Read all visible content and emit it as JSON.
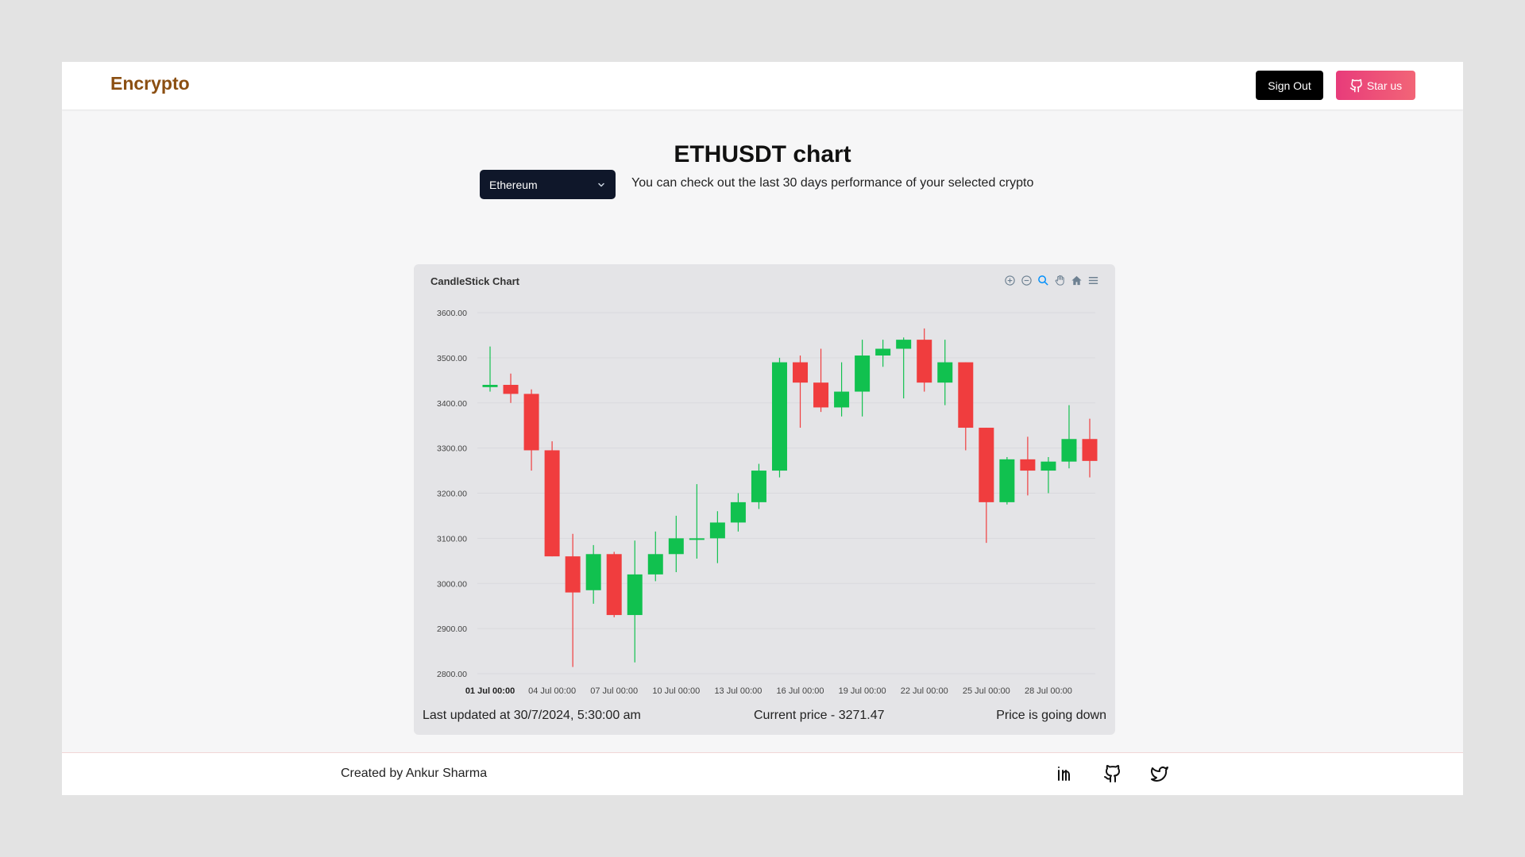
{
  "header": {
    "logo": "Encrypto",
    "signout_label": "Sign Out",
    "star_label": "Star us"
  },
  "main": {
    "title": "ETHUSDT chart",
    "select": {
      "selected": "Ethereum"
    },
    "subtitle": "You can check out the last 30 days performance of your selected crypto"
  },
  "chart_card": {
    "title": "CandleStick Chart",
    "toolbar_icons": [
      "zoom-in-icon",
      "zoom-out-icon",
      "zoom-selection-icon",
      "pan-hand-icon",
      "reset-home-icon",
      "menu-icon"
    ],
    "footer": {
      "updated": "Last updated at 30/7/2024, 5:30:00 am",
      "current_price": "Current price - 3271.47",
      "trend": "Price is going down"
    }
  },
  "chart_data": {
    "type": "candlestick",
    "title": "CandleStick Chart",
    "colors": {
      "up": "#11c14f",
      "down": "#f03d3e"
    },
    "ylim": [
      2800,
      3600
    ],
    "yticks": [
      "3600.00",
      "3500.00",
      "3400.00",
      "3300.00",
      "3200.00",
      "3100.00",
      "3000.00",
      "2900.00",
      "2800.00"
    ],
    "xticks": [
      {
        "label": "01 Jul 00:00",
        "index": 0,
        "bold": true
      },
      {
        "label": "04 Jul 00:00",
        "index": 3
      },
      {
        "label": "07 Jul 00:00",
        "index": 6
      },
      {
        "label": "10 Jul 00:00",
        "index": 9
      },
      {
        "label": "13 Jul 00:00",
        "index": 12
      },
      {
        "label": "16 Jul 00:00",
        "index": 15
      },
      {
        "label": "19 Jul 00:00",
        "index": 18
      },
      {
        "label": "22 Jul 00:00",
        "index": 21
      },
      {
        "label": "25 Jul 00:00",
        "index": 24
      },
      {
        "label": "28 Jul 00:00",
        "index": 27
      }
    ],
    "grid": true,
    "candles": [
      {
        "o": 3435,
        "h": 3525,
        "l": 3425,
        "c": 3440
      },
      {
        "o": 3440,
        "h": 3465,
        "l": 3400,
        "c": 3420
      },
      {
        "o": 3420,
        "h": 3430,
        "l": 3250,
        "c": 3295
      },
      {
        "o": 3295,
        "h": 3315,
        "l": 3060,
        "c": 3060
      },
      {
        "o": 3060,
        "h": 3110,
        "l": 2815,
        "c": 2980
      },
      {
        "o": 2985,
        "h": 3085,
        "l": 2955,
        "c": 3065
      },
      {
        "o": 3065,
        "h": 3070,
        "l": 2925,
        "c": 2930
      },
      {
        "o": 2930,
        "h": 3095,
        "l": 2825,
        "c": 3020
      },
      {
        "o": 3020,
        "h": 3115,
        "l": 3005,
        "c": 3065
      },
      {
        "o": 3065,
        "h": 3150,
        "l": 3025,
        "c": 3100
      },
      {
        "o": 3100,
        "h": 3220,
        "l": 3055,
        "c": 3100
      },
      {
        "o": 3100,
        "h": 3160,
        "l": 3045,
        "c": 3135
      },
      {
        "o": 3135,
        "h": 3200,
        "l": 3115,
        "c": 3180
      },
      {
        "o": 3180,
        "h": 3265,
        "l": 3165,
        "c": 3250
      },
      {
        "o": 3250,
        "h": 3500,
        "l": 3235,
        "c": 3490
      },
      {
        "o": 3490,
        "h": 3505,
        "l": 3345,
        "c": 3445
      },
      {
        "o": 3445,
        "h": 3520,
        "l": 3380,
        "c": 3390
      },
      {
        "o": 3390,
        "h": 3490,
        "l": 3370,
        "c": 3425
      },
      {
        "o": 3425,
        "h": 3540,
        "l": 3370,
        "c": 3505
      },
      {
        "o": 3505,
        "h": 3540,
        "l": 3480,
        "c": 3520
      },
      {
        "o": 3520,
        "h": 3545,
        "l": 3410,
        "c": 3540
      },
      {
        "o": 3540,
        "h": 3565,
        "l": 3425,
        "c": 3445
      },
      {
        "o": 3445,
        "h": 3540,
        "l": 3395,
        "c": 3490
      },
      {
        "o": 3490,
        "h": 3490,
        "l": 3295,
        "c": 3345
      },
      {
        "o": 3345,
        "h": 3345,
        "l": 3090,
        "c": 3180
      },
      {
        "o": 3180,
        "h": 3280,
        "l": 3175,
        "c": 3275
      },
      {
        "o": 3275,
        "h": 3325,
        "l": 3195,
        "c": 3250
      },
      {
        "o": 3250,
        "h": 3280,
        "l": 3200,
        "c": 3270
      },
      {
        "o": 3270,
        "h": 3395,
        "l": 3255,
        "c": 3320
      },
      {
        "o": 3320,
        "h": 3365,
        "l": 3235,
        "c": 3271.47
      }
    ]
  },
  "footer": {
    "credit": "Created by Ankur Sharma",
    "social_icons": [
      "linkedin-icon",
      "github-icon",
      "twitter-icon"
    ]
  }
}
